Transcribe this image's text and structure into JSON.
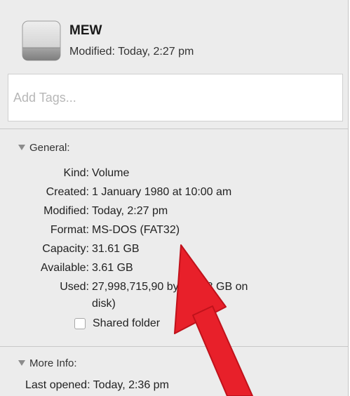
{
  "header": {
    "title": "MEW",
    "modified": "Modified: Today, 2:27 pm"
  },
  "tags": {
    "placeholder": "Add Tags..."
  },
  "general": {
    "header": "General:",
    "rows": [
      {
        "key": "Kind:",
        "value": "Volume"
      },
      {
        "key": "Created:",
        "value": "1 January 1980 at 10:00 am"
      },
      {
        "key": "Modified:",
        "value": "Today, 2:27 pm"
      },
      {
        "key": "Format:",
        "value": "MS-DOS (FAT32)"
      },
      {
        "key": "Capacity:",
        "value": "31.61 GB"
      },
      {
        "key": "Available:",
        "value": "3.61 GB"
      },
      {
        "key": "Used:",
        "value": "27,998,715,90 bytes (28 GB on",
        "continuation": "disk)"
      }
    ],
    "shared_folder_label": "Shared folder",
    "shared_folder_checked": false
  },
  "more_info": {
    "header": "More Info:",
    "last_opened": "Last opened: Today, 2:36 pm"
  },
  "icons": {
    "drive": "external-drive-icon",
    "disclosure": "disclosure-triangle-icon",
    "annotation": "red-arrow"
  },
  "colors": {
    "panel": "#ececec",
    "arrow": "#e8202a"
  }
}
